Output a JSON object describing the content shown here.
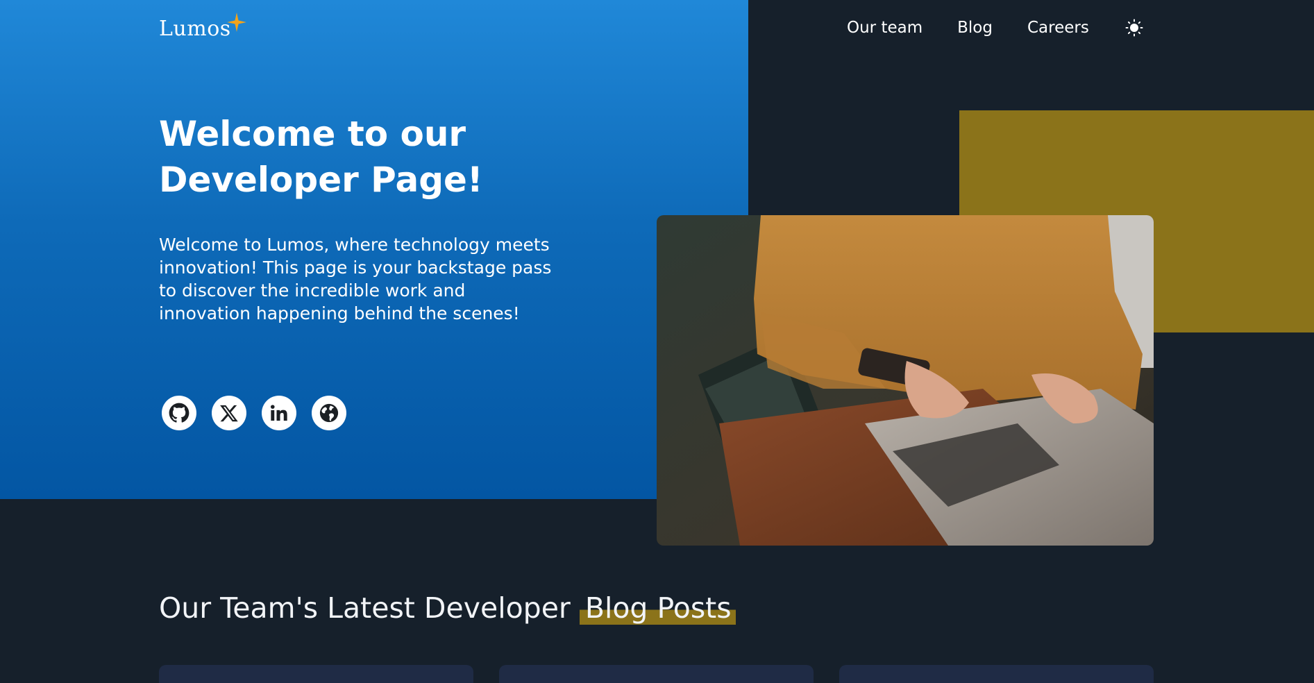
{
  "brand": {
    "logo_text": "Lumos",
    "logo_icon": "four-point-star-icon"
  },
  "nav": {
    "items": [
      {
        "label": "Our team"
      },
      {
        "label": "Blog"
      },
      {
        "label": "Careers"
      }
    ],
    "theme_toggle_icon": "sun-icon"
  },
  "hero": {
    "title": "Welcome to our Developer Page!",
    "description": "Welcome to Lumos, where technology meets innovation! This page is your backstage pass to discover the incredible work and innovation happening behind the scenes!",
    "socials": [
      {
        "icon": "github-icon"
      },
      {
        "icon": "x-icon"
      },
      {
        "icon": "linkedin-icon"
      },
      {
        "icon": "globe-icon"
      }
    ]
  },
  "blog_section": {
    "title_plain": "Our Team's Latest Developer ",
    "title_highlight": "Blog Posts"
  },
  "colors": {
    "hero_blue": "#0e6ab8",
    "background": "#16202b",
    "accent_gold": "#8b731a",
    "card": "#1f2b45"
  }
}
